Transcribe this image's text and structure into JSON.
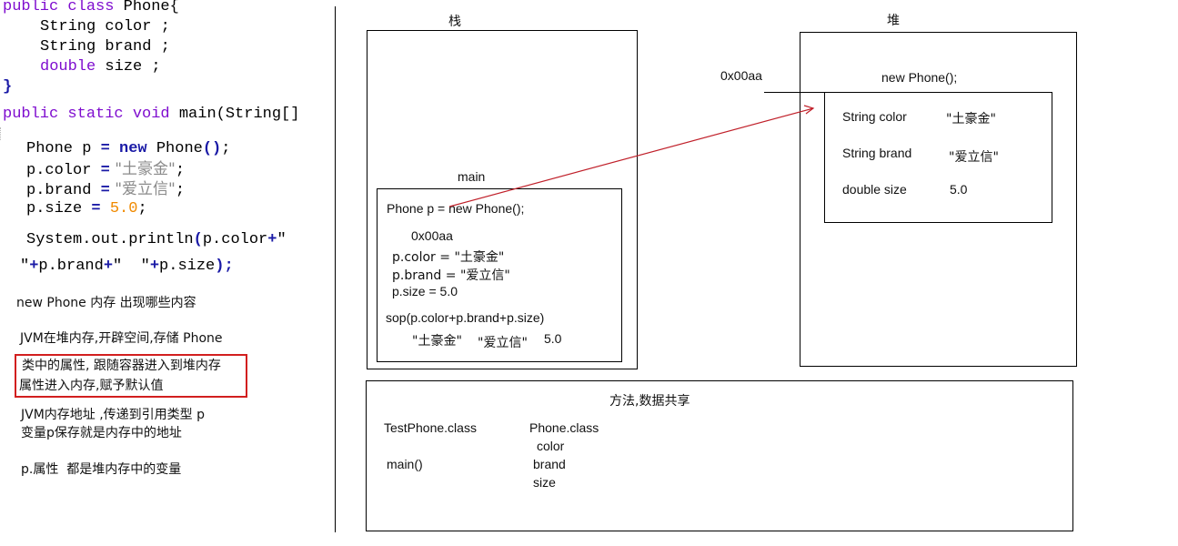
{
  "code": {
    "class_decl": {
      "kw": "public class",
      "name": "Phone{"
    },
    "fields": [
      {
        "type": "String",
        "name": "color ;"
      },
      {
        "type": "String",
        "name": "brand ;"
      },
      {
        "type": "double",
        "name": "size ;"
      }
    ],
    "close_brace": "}",
    "main_decl": {
      "kw": "public static void",
      "rest": "main(String[]"
    },
    "stmt1": {
      "a": "Phone p ",
      "eq": "=",
      "kw": " new",
      "b": " Phone",
      "paren": "()",
      "semi": ";"
    },
    "stmt2": {
      "a": "p.color ",
      "eq": "=",
      "str": " \"土豪金\"",
      "semi": ";"
    },
    "stmt3": {
      "a": "p.brand ",
      "eq": "=",
      "str": " \"爱立信\"",
      "semi": ";"
    },
    "stmt4": {
      "a": "p.size ",
      "eq": "=",
      "num": " 5.0",
      "semi": ";"
    },
    "println1": {
      "a": "System.out.println",
      "paren": "(",
      "b": "p.color",
      "plus": "+",
      "q": "\""
    },
    "println2": {
      "q": "\"",
      "plus1": "+",
      "a": "p.brand",
      "plus2": "+",
      "q2": "\"  \"",
      "plus3": "+",
      "b": "p.size",
      "end": ");"
    }
  },
  "notes": {
    "n1": "new Phone 内存 出现哪些内容",
    "n2": "JVM在堆内存,开辟空间,存储 Phone",
    "highlight": [
      "类中的属性, 跟随容器进入到堆内存",
      "属性进入内存,赋予默认值"
    ],
    "n3": [
      "JVM内存地址 ,传递到引用类型 p",
      "变量p保存就是内存中的地址"
    ],
    "n4": "p.属性  都是堆内存中的变量"
  },
  "stack": {
    "title": "栈",
    "frame_title": "main",
    "lines": {
      "decl": "Phone p = new Phone();",
      "addr": "0x00aa",
      "color": "p.color = \"土豪金\"",
      "brand": "p.brand = \"爱立信\"",
      "size": "p.size = 5.0",
      "sop": "sop(p.color+p.brand+p.size)",
      "out1": "\"土豪金\"",
      "out2": "\"爱立信\"",
      "out3": "5.0"
    }
  },
  "heap": {
    "title": "堆",
    "address": "0x00aa",
    "object_title": "new Phone();",
    "fields": [
      {
        "decl": "String color",
        "value": "\"土豪金\""
      },
      {
        "decl": "String brand",
        "value": "\"爱立信\""
      },
      {
        "decl": "double size",
        "value": "5.0"
      }
    ]
  },
  "method_area": {
    "title": "方法,数据共享",
    "test_class": "TestPhone.class",
    "test_method": "main()",
    "phone_class": "Phone.class",
    "phone_fields": [
      "color",
      "brand",
      "size"
    ]
  },
  "colors": {
    "arrow": "#c0202a",
    "highlight_border": "#d21f1f"
  }
}
